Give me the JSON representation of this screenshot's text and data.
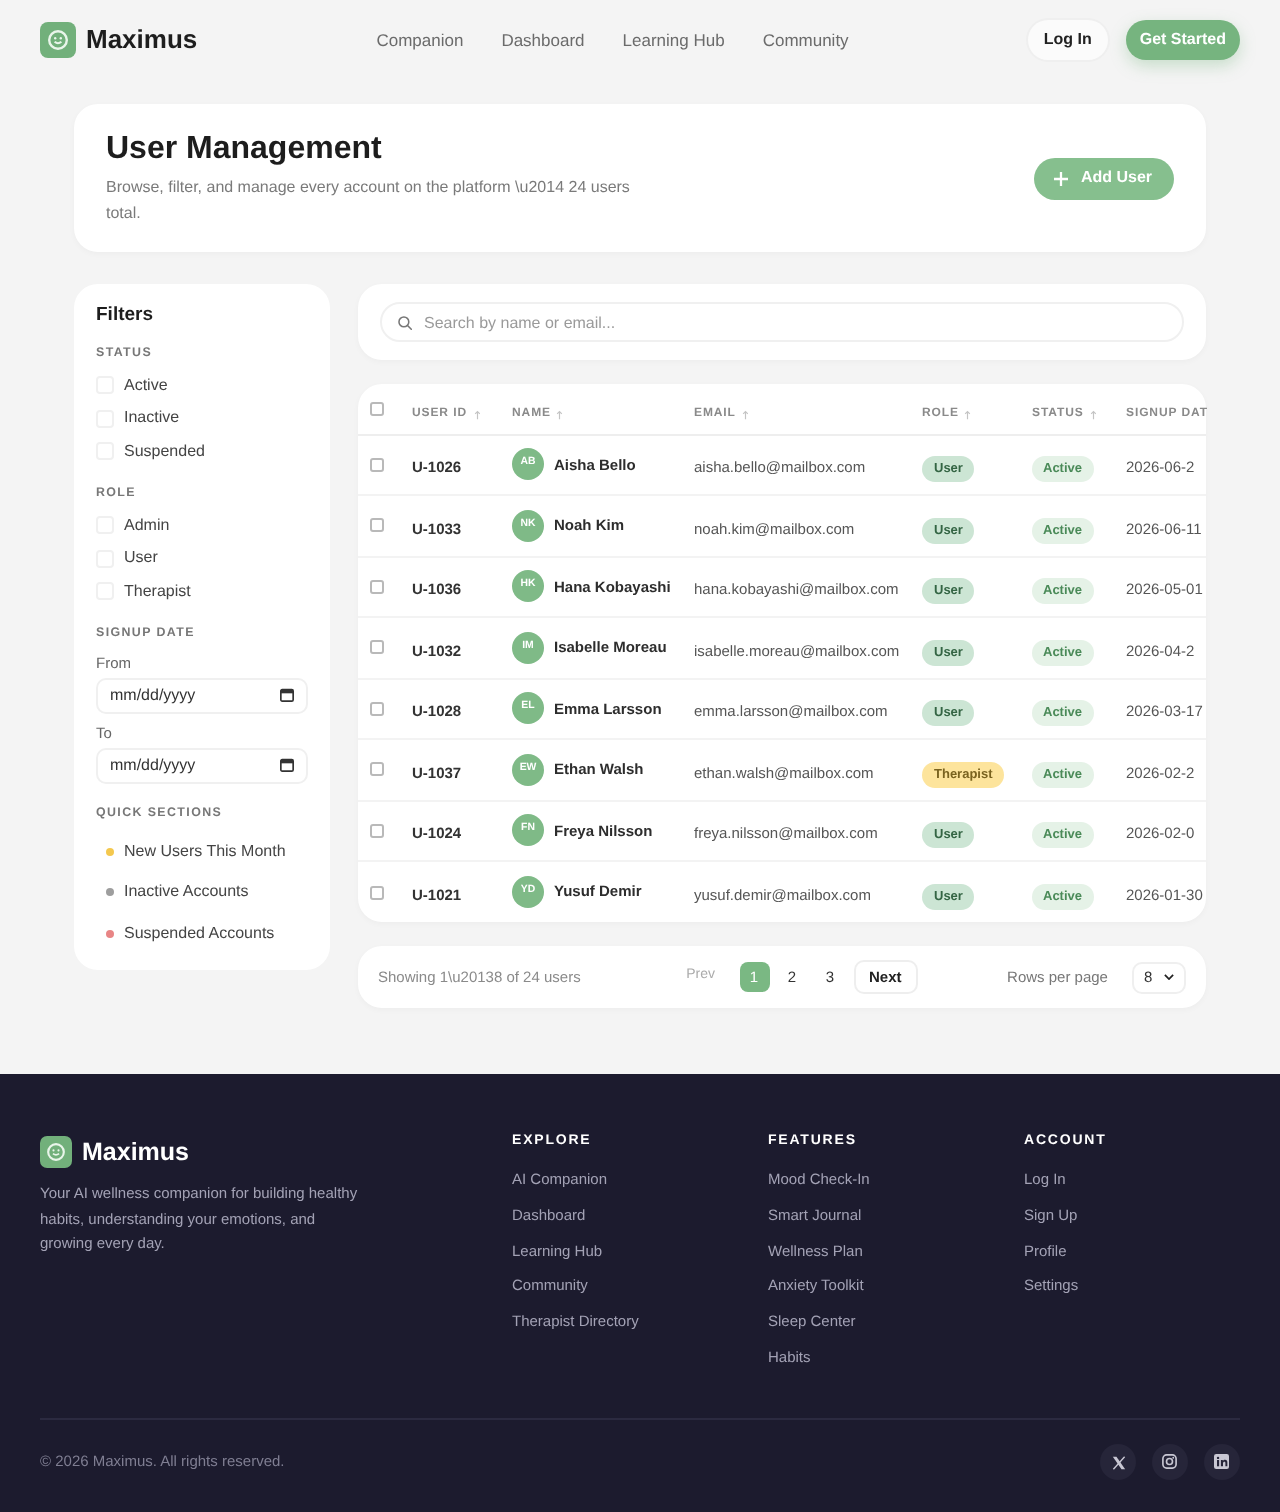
{
  "header": {
    "brand": "Maximus",
    "nav": [
      "Companion",
      "Dashboard",
      "Learning Hub",
      "Community"
    ],
    "login": "Log In",
    "cta": "Get Started"
  },
  "page_header": {
    "title": "User Management",
    "subtitle": "Browse, filter, and manage every account on the platform \\u2014 24 users total.",
    "add_button": "Add User"
  },
  "filters": {
    "title": "Filters",
    "status": {
      "heading": "STATUS",
      "options": [
        {
          "label": "Active",
          "checked": false
        },
        {
          "label": "Inactive",
          "checked": false
        },
        {
          "label": "Suspended",
          "checked": false
        }
      ]
    },
    "role": {
      "heading": "ROLE",
      "options": [
        {
          "label": "Admin",
          "checked": false
        },
        {
          "label": "User",
          "checked": false
        },
        {
          "label": "Therapist",
          "checked": false
        }
      ]
    },
    "signup_date": {
      "heading": "SIGNUP DATE",
      "from": {
        "label": "From",
        "placeholder": "mm/dd/yyyy"
      },
      "to": {
        "label": "To",
        "placeholder": "mm/dd/yyyy"
      }
    },
    "quick_sections": {
      "heading": "QUICK SECTIONS",
      "items": [
        {
          "label": "New Users This Month",
          "color": "#f4c84e"
        },
        {
          "label": "Inactive Accounts",
          "color": "#9e9e9e"
        },
        {
          "label": "Suspended Accounts",
          "color": "#e88585"
        }
      ]
    }
  },
  "search": {
    "placeholder": "Search by name or email..."
  },
  "table": {
    "select_all": {
      "checked": false
    },
    "columns": [
      {
        "label": "USER ID",
        "sort_arrow": true
      },
      {
        "label": "NAME",
        "sort_arrow": true
      },
      {
        "label": "EMAIL",
        "sort_arrow": true
      },
      {
        "label": "ROLE",
        "sort_arrow": true
      },
      {
        "label": "STATUS",
        "sort_arrow": true
      },
      {
        "label": "SIGNUP DAT",
        "sort_arrow": false
      }
    ],
    "rows": [
      {
        "checked": false,
        "user_id": "U-1026",
        "initials": "AB",
        "name": "Aisha Bello",
        "email": "aisha.bello@mailbox.com",
        "role": {
          "label": "User",
          "color": "#cce5d4"
        },
        "status": "Active",
        "signup_date": "2026-06-2"
      },
      {
        "checked": false,
        "user_id": "U-1033",
        "initials": "NK",
        "name": "Noah Kim",
        "email": "noah.kim@mailbox.com",
        "role": {
          "label": "User",
          "color": "#cce5d4"
        },
        "status": "Active",
        "signup_date": "2026-06-11"
      },
      {
        "checked": false,
        "user_id": "U-1036",
        "initials": "HK",
        "name": "Hana Kobayashi",
        "email": "hana.kobayashi@mailbox.com",
        "role": {
          "label": "User",
          "color": "#cce5d4"
        },
        "status": "Active",
        "signup_date": "2026-05-01"
      },
      {
        "checked": false,
        "user_id": "U-1032",
        "initials": "IM",
        "name": "Isabelle Moreau",
        "email": "isabelle.moreau@mailbox.com",
        "role": {
          "label": "User",
          "color": "#cce5d4"
        },
        "status": "Active",
        "signup_date": "2026-04-2"
      },
      {
        "checked": false,
        "user_id": "U-1028",
        "initials": "EL",
        "name": "Emma Larsson",
        "email": "emma.larsson@mailbox.com",
        "role": {
          "label": "User",
          "color": "#cce5d4"
        },
        "status": "Active",
        "signup_date": "2026-03-17"
      },
      {
        "checked": false,
        "user_id": "U-1037",
        "initials": "EW",
        "name": "Ethan Walsh",
        "email": "ethan.walsh@mailbox.com",
        "role": {
          "label": "Therapist",
          "color": "#fde49c"
        },
        "status": "Active",
        "signup_date": "2026-02-2"
      },
      {
        "checked": false,
        "user_id": "U-1024",
        "initials": "FN",
        "name": "Freya Nilsson",
        "email": "freya.nilsson@mailbox.com",
        "role": {
          "label": "User",
          "color": "#cce5d4"
        },
        "status": "Active",
        "signup_date": "2026-02-0"
      },
      {
        "checked": false,
        "user_id": "U-1021",
        "initials": "YD",
        "name": "Yusuf Demir",
        "email": "yusuf.demir@mailbox.com",
        "role": {
          "label": "User",
          "color": "#cce5d4"
        },
        "status": "Active",
        "signup_date": "2026-01-30"
      }
    ]
  },
  "pagination": {
    "summary": "Showing 1\\u20138 of 24 users",
    "prev": {
      "label": "Prev",
      "disabled": true
    },
    "pages": [
      {
        "label": "1",
        "selected": true
      },
      {
        "label": "2",
        "selected": false
      },
      {
        "label": "3",
        "selected": false
      }
    ],
    "next": {
      "label": "Next",
      "disabled": false
    },
    "rows_per_page": {
      "label": "Rows per page",
      "value": "8"
    }
  },
  "footer": {
    "brand": "Maximus",
    "description": "Your AI wellness companion for building healthy habits, understanding your emotions, and growing every day.",
    "columns": [
      {
        "heading": "EXPLORE",
        "links": [
          "AI Companion",
          "Dashboard",
          "Learning Hub",
          "Community",
          "Therapist Directory"
        ]
      },
      {
        "heading": "FEATURES",
        "links": [
          "Mood Check-In",
          "Smart Journal",
          "Wellness Plan",
          "Anxiety Toolkit",
          "Sleep Center",
          "Habits"
        ]
      },
      {
        "heading": "ACCOUNT",
        "links": [
          "Log In",
          "Sign Up",
          "Profile",
          "Settings"
        ]
      }
    ],
    "copyright": "© 2026 Maximus. All rights reserved.",
    "social": [
      {
        "kind": "x"
      },
      {
        "kind": "instagram"
      },
      {
        "kind": "linkedin"
      }
    ]
  }
}
